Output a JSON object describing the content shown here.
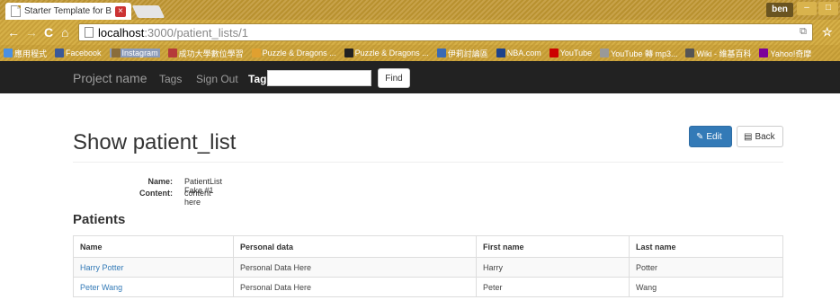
{
  "browser": {
    "tab_title": "Starter Template for Bo",
    "tab_close": "×",
    "user_name": "ben",
    "url_host": "localhost",
    "url_path": ":3000/patient_lists/1",
    "bookmarks": [
      {
        "label": "應用程式",
        "icon_color": "#4a90e2"
      },
      {
        "label": "Facebook",
        "icon_color": "#3b5998"
      },
      {
        "label": "Instagram",
        "icon_color": "#8a6d3b",
        "active": true
      },
      {
        "label": "成功大學數位學習",
        "icon_color": "#b53a3a"
      },
      {
        "label": "Puzzle & Dragons ...",
        "icon_color": "#e0a030"
      },
      {
        "label": "Puzzle & Dragons ...",
        "icon_color": "#222222"
      },
      {
        "label": "伊莉討論區",
        "icon_color": "#3a6ab5"
      },
      {
        "label": "NBA.com",
        "icon_color": "#1d428a"
      },
      {
        "label": "YouTube",
        "icon_color": "#cc0000"
      },
      {
        "label": "YouTube 轉 mp3...",
        "icon_color": "#999999"
      },
      {
        "label": "Wiki - 維基百科",
        "icon_color": "#555555"
      },
      {
        "label": "Yahoo!奇摩",
        "icon_color": "#7b0099"
      }
    ]
  },
  "navbar": {
    "brand": "Project name",
    "links": [
      "Tags",
      "Sign Out"
    ],
    "tag_label": "Tag",
    "tag_value": "",
    "find_label": "Find"
  },
  "page": {
    "title": "Show patient_list",
    "edit_label": "Edit",
    "back_label": "Back",
    "details": [
      {
        "label": "Name:",
        "value": "PatientList Fake #1"
      },
      {
        "label": "Content:",
        "value": "content here"
      }
    ],
    "section_title": "Patients",
    "table": {
      "headers": [
        "Name",
        "Personal data",
        "First name",
        "Last name"
      ],
      "rows": [
        [
          "Harry Potter",
          "Personal Data Here",
          "Harry",
          "Potter"
        ],
        [
          "Peter Wang",
          "Personal Data Here",
          "Peter",
          "Wang"
        ]
      ]
    }
  }
}
